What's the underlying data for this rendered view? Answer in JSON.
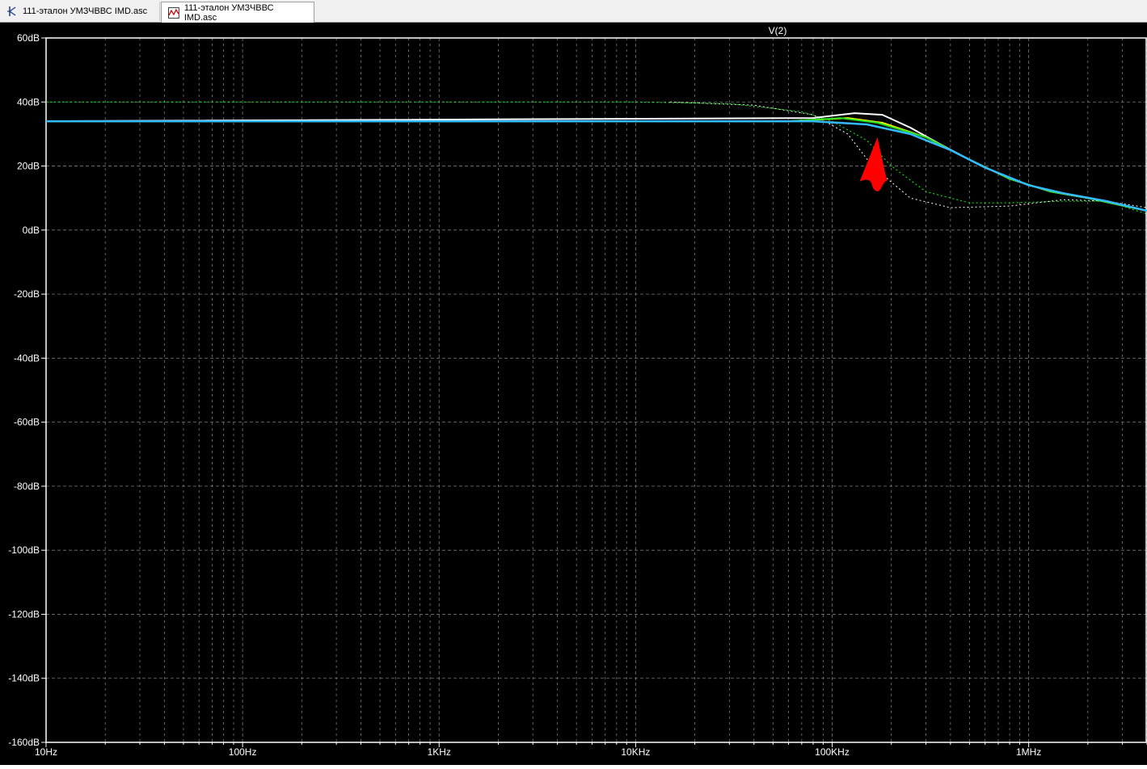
{
  "tabs": [
    {
      "label": "111-эталон УМЗЧВВС IMD.asc",
      "icon": "schematic-icon",
      "active": false
    },
    {
      "label": "111-эталон УМЗЧВВС IMD.asc",
      "icon": "waveform-icon",
      "active": true
    }
  ],
  "plot": {
    "title": "V(2)",
    "background": "#000000",
    "grid_color": "#7a7a7a",
    "axis_color": "#ffffff"
  },
  "chart_data": {
    "type": "line",
    "title": "V(2)",
    "x_scale": "log",
    "x_range": [
      10,
      4000000
    ],
    "y_range": [
      -160,
      60
    ],
    "x_unit": "Hz",
    "y_unit": "dB",
    "x_ticks": [
      {
        "value": 10,
        "label": "10Hz"
      },
      {
        "value": 100,
        "label": "100Hz"
      },
      {
        "value": 1000,
        "label": "1KHz"
      },
      {
        "value": 10000,
        "label": "10KHz"
      },
      {
        "value": 100000,
        "label": "100KHz"
      },
      {
        "value": 1000000,
        "label": "1MHz"
      }
    ],
    "y_ticks": [
      {
        "value": 60,
        "label": "60dB"
      },
      {
        "value": 40,
        "label": "40dB"
      },
      {
        "value": 20,
        "label": "20dB"
      },
      {
        "value": 0,
        "label": "0dB"
      },
      {
        "value": -20,
        "label": "-20dB"
      },
      {
        "value": -40,
        "label": "-40dB"
      },
      {
        "value": -60,
        "label": "-60dB"
      },
      {
        "value": -80,
        "label": "-80dB"
      },
      {
        "value": -100,
        "label": "-100dB"
      },
      {
        "value": -120,
        "label": "-120dB"
      },
      {
        "value": -140,
        "label": "-140dB"
      },
      {
        "value": -160,
        "label": "-160dB"
      }
    ],
    "grid": true,
    "series": [
      {
        "color": "#00ff00",
        "style": "dotted",
        "width": 1,
        "points": [
          [
            10,
            40
          ],
          [
            10000,
            40
          ],
          [
            30000,
            39.5
          ],
          [
            70000,
            37
          ],
          [
            100000,
            34
          ],
          [
            150000,
            28
          ],
          [
            200000,
            20
          ],
          [
            300000,
            12
          ],
          [
            500000,
            8.5
          ],
          [
            800000,
            8.5
          ],
          [
            1500000,
            9
          ],
          [
            2500000,
            9
          ],
          [
            4000000,
            5
          ]
        ]
      },
      {
        "color": "#ffffff",
        "style": "dotted",
        "width": 1,
        "points": [
          [
            15000,
            40
          ],
          [
            40000,
            39
          ],
          [
            80000,
            36
          ],
          [
            120000,
            30
          ],
          [
            160000,
            20
          ],
          [
            250000,
            10
          ],
          [
            400000,
            7
          ],
          [
            800000,
            7.5
          ],
          [
            1500000,
            9.5
          ],
          [
            2500000,
            9
          ],
          [
            4000000,
            7
          ]
        ]
      },
      {
        "color": "#ffffff",
        "style": "solid",
        "width": 2,
        "points": [
          [
            10,
            34
          ],
          [
            80000,
            35
          ],
          [
            130000,
            36.5
          ],
          [
            180000,
            36
          ],
          [
            250000,
            32
          ],
          [
            350000,
            27
          ],
          [
            500000,
            22
          ],
          [
            800000,
            16
          ],
          [
            1300000,
            12
          ],
          [
            2000000,
            10
          ],
          [
            4000000,
            6
          ]
        ]
      },
      {
        "color": "#ffff00",
        "style": "solid",
        "width": 2,
        "points": [
          [
            10,
            34
          ],
          [
            60000,
            34
          ],
          [
            120000,
            35
          ],
          [
            180000,
            33.5
          ],
          [
            300000,
            29
          ],
          [
            500000,
            22
          ],
          [
            800000,
            16
          ],
          [
            1300000,
            12
          ],
          [
            2000000,
            10
          ],
          [
            4000000,
            6
          ]
        ]
      },
      {
        "color": "#22dd22",
        "style": "solid",
        "width": 2,
        "points": [
          [
            10,
            34
          ],
          [
            60000,
            34
          ],
          [
            110000,
            35
          ],
          [
            170000,
            33.5
          ],
          [
            300000,
            29
          ],
          [
            500000,
            22
          ],
          [
            800000,
            16
          ],
          [
            1300000,
            12
          ],
          [
            2000000,
            10
          ],
          [
            4000000,
            6
          ]
        ]
      },
      {
        "color": "#33bbff",
        "style": "solid",
        "width": 2.5,
        "points": [
          [
            10,
            34
          ],
          [
            80000,
            34
          ],
          [
            150000,
            33
          ],
          [
            250000,
            30
          ],
          [
            400000,
            25
          ],
          [
            600000,
            19.5
          ],
          [
            1000000,
            14
          ],
          [
            1500000,
            11.5
          ],
          [
            2500000,
            9
          ],
          [
            4000000,
            6
          ]
        ]
      }
    ],
    "annotation": {
      "type": "arrow",
      "color": "#ff0000",
      "x": 170000,
      "y": 29
    }
  }
}
